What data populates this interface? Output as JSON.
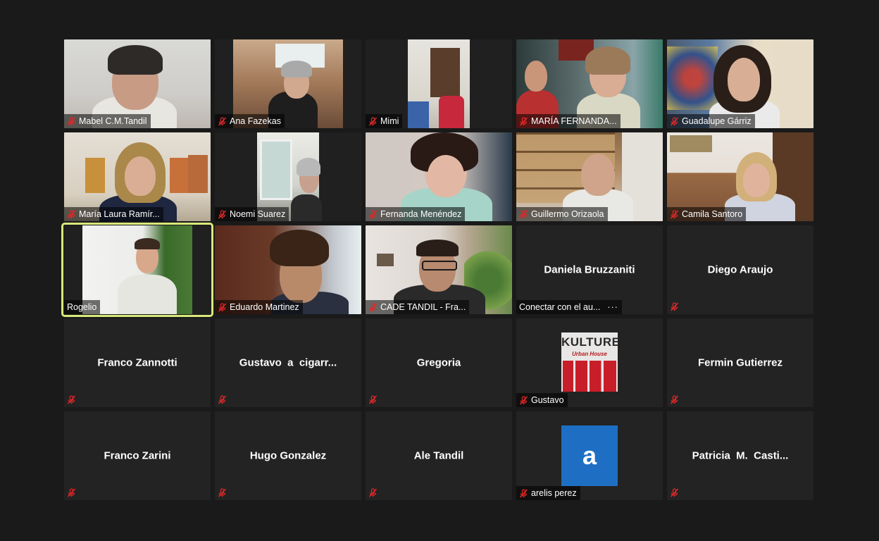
{
  "colors": {
    "background": "#1a1a1a",
    "tile_bg": "#232323",
    "active_speaker_border": "#d9e87a",
    "muted_mic": "#e02828",
    "avatar_blue": "#1e6fc4"
  },
  "participants": [
    {
      "name": "Mabel C.M.Tandil",
      "muted": true,
      "video": true
    },
    {
      "name": "Ana Fazekas",
      "muted": true,
      "video": true
    },
    {
      "name": "Mimi",
      "muted": true,
      "video": true
    },
    {
      "name": "MARÍA FERNANDA...",
      "muted": true,
      "video": true
    },
    {
      "name": "Guadalupe Gárriz",
      "muted": true,
      "video": true
    },
    {
      "name": "María Laura Ramír...",
      "muted": true,
      "video": true
    },
    {
      "name": "Noemi Suarez",
      "muted": true,
      "video": true
    },
    {
      "name": "Fernanda Menéndez",
      "muted": true,
      "video": true
    },
    {
      "name": "Guillermo Orizaola",
      "muted": true,
      "video": true
    },
    {
      "name": "Camila Santoro",
      "muted": true,
      "video": true
    },
    {
      "name": "Rogelio",
      "muted": false,
      "video": true,
      "active_speaker": true
    },
    {
      "name": "Eduardo Martinez",
      "muted": true,
      "video": true
    },
    {
      "name": "CADE TANDIL - Fra...",
      "muted": true,
      "video": true
    },
    {
      "name": "Daniela Bruzzaniti",
      "label": "Conectar con el au...",
      "label_suffix": "···",
      "video": false
    },
    {
      "name": "Diego Araujo",
      "muted": true,
      "video": false
    },
    {
      "name": "Franco Zannotti",
      "muted": true,
      "video": false
    },
    {
      "name": "Gustavo  a  cigarr...",
      "muted": true,
      "video": false
    },
    {
      "name": "Gregoria",
      "muted": true,
      "video": false
    },
    {
      "name": "Gustavo",
      "muted": true,
      "video": false,
      "avatar": "kulture",
      "avatar_title": "KULTURE",
      "avatar_subtitle": "Urban House"
    },
    {
      "name": "Fermin Gutierrez",
      "muted": true,
      "video": false
    },
    {
      "name": "Franco Zarini",
      "muted": true,
      "video": false
    },
    {
      "name": "Hugo Gonzalez",
      "muted": true,
      "video": false
    },
    {
      "name": "Ale Tandil",
      "muted": true,
      "video": false
    },
    {
      "name": "arelis perez",
      "muted": true,
      "video": false,
      "avatar": "letter",
      "avatar_letter": "a"
    },
    {
      "name": "Patricia  M.  Casti...",
      "muted": true,
      "video": false
    }
  ],
  "icons": {
    "muted": "mic-muted-icon"
  }
}
